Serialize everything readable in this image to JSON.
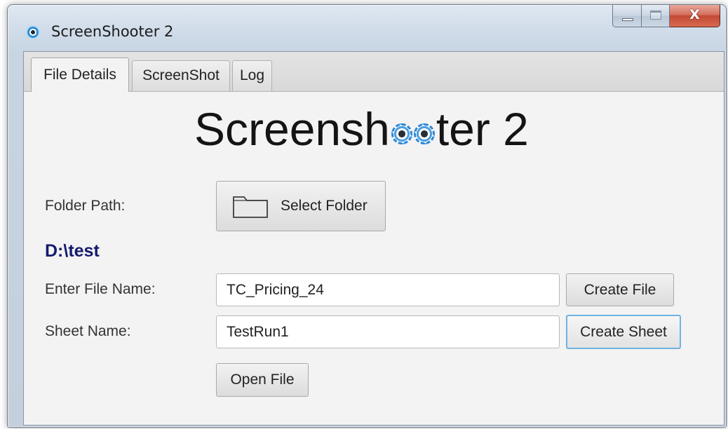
{
  "window": {
    "title": "ScreenShooter 2",
    "close_glyph": "X",
    "icons": {
      "app": "app-eye-icon",
      "minimize": "minimize-icon",
      "maximize": "maximize-icon",
      "close": "close-icon"
    }
  },
  "tabs": [
    {
      "label": "File Details",
      "active": true
    },
    {
      "label": "ScreenShot",
      "active": false
    },
    {
      "label": "Log",
      "active": false
    }
  ],
  "logo": {
    "text_before": "Screensh",
    "text_after": "ter 2",
    "eye_color": "#2d86d3"
  },
  "folder": {
    "label": "Folder Path:",
    "button_label": "Select Folder",
    "button_icon": "folder-icon",
    "current_path": "D:\\test",
    "path_color": "#141a6e"
  },
  "file": {
    "label": "Enter File Name:",
    "value": "TC_Pricing_24",
    "create_button": "Create File"
  },
  "sheet": {
    "label": "Sheet Name:",
    "value": "TestRun1",
    "create_button": "Create Sheet"
  },
  "open_button": "Open File"
}
